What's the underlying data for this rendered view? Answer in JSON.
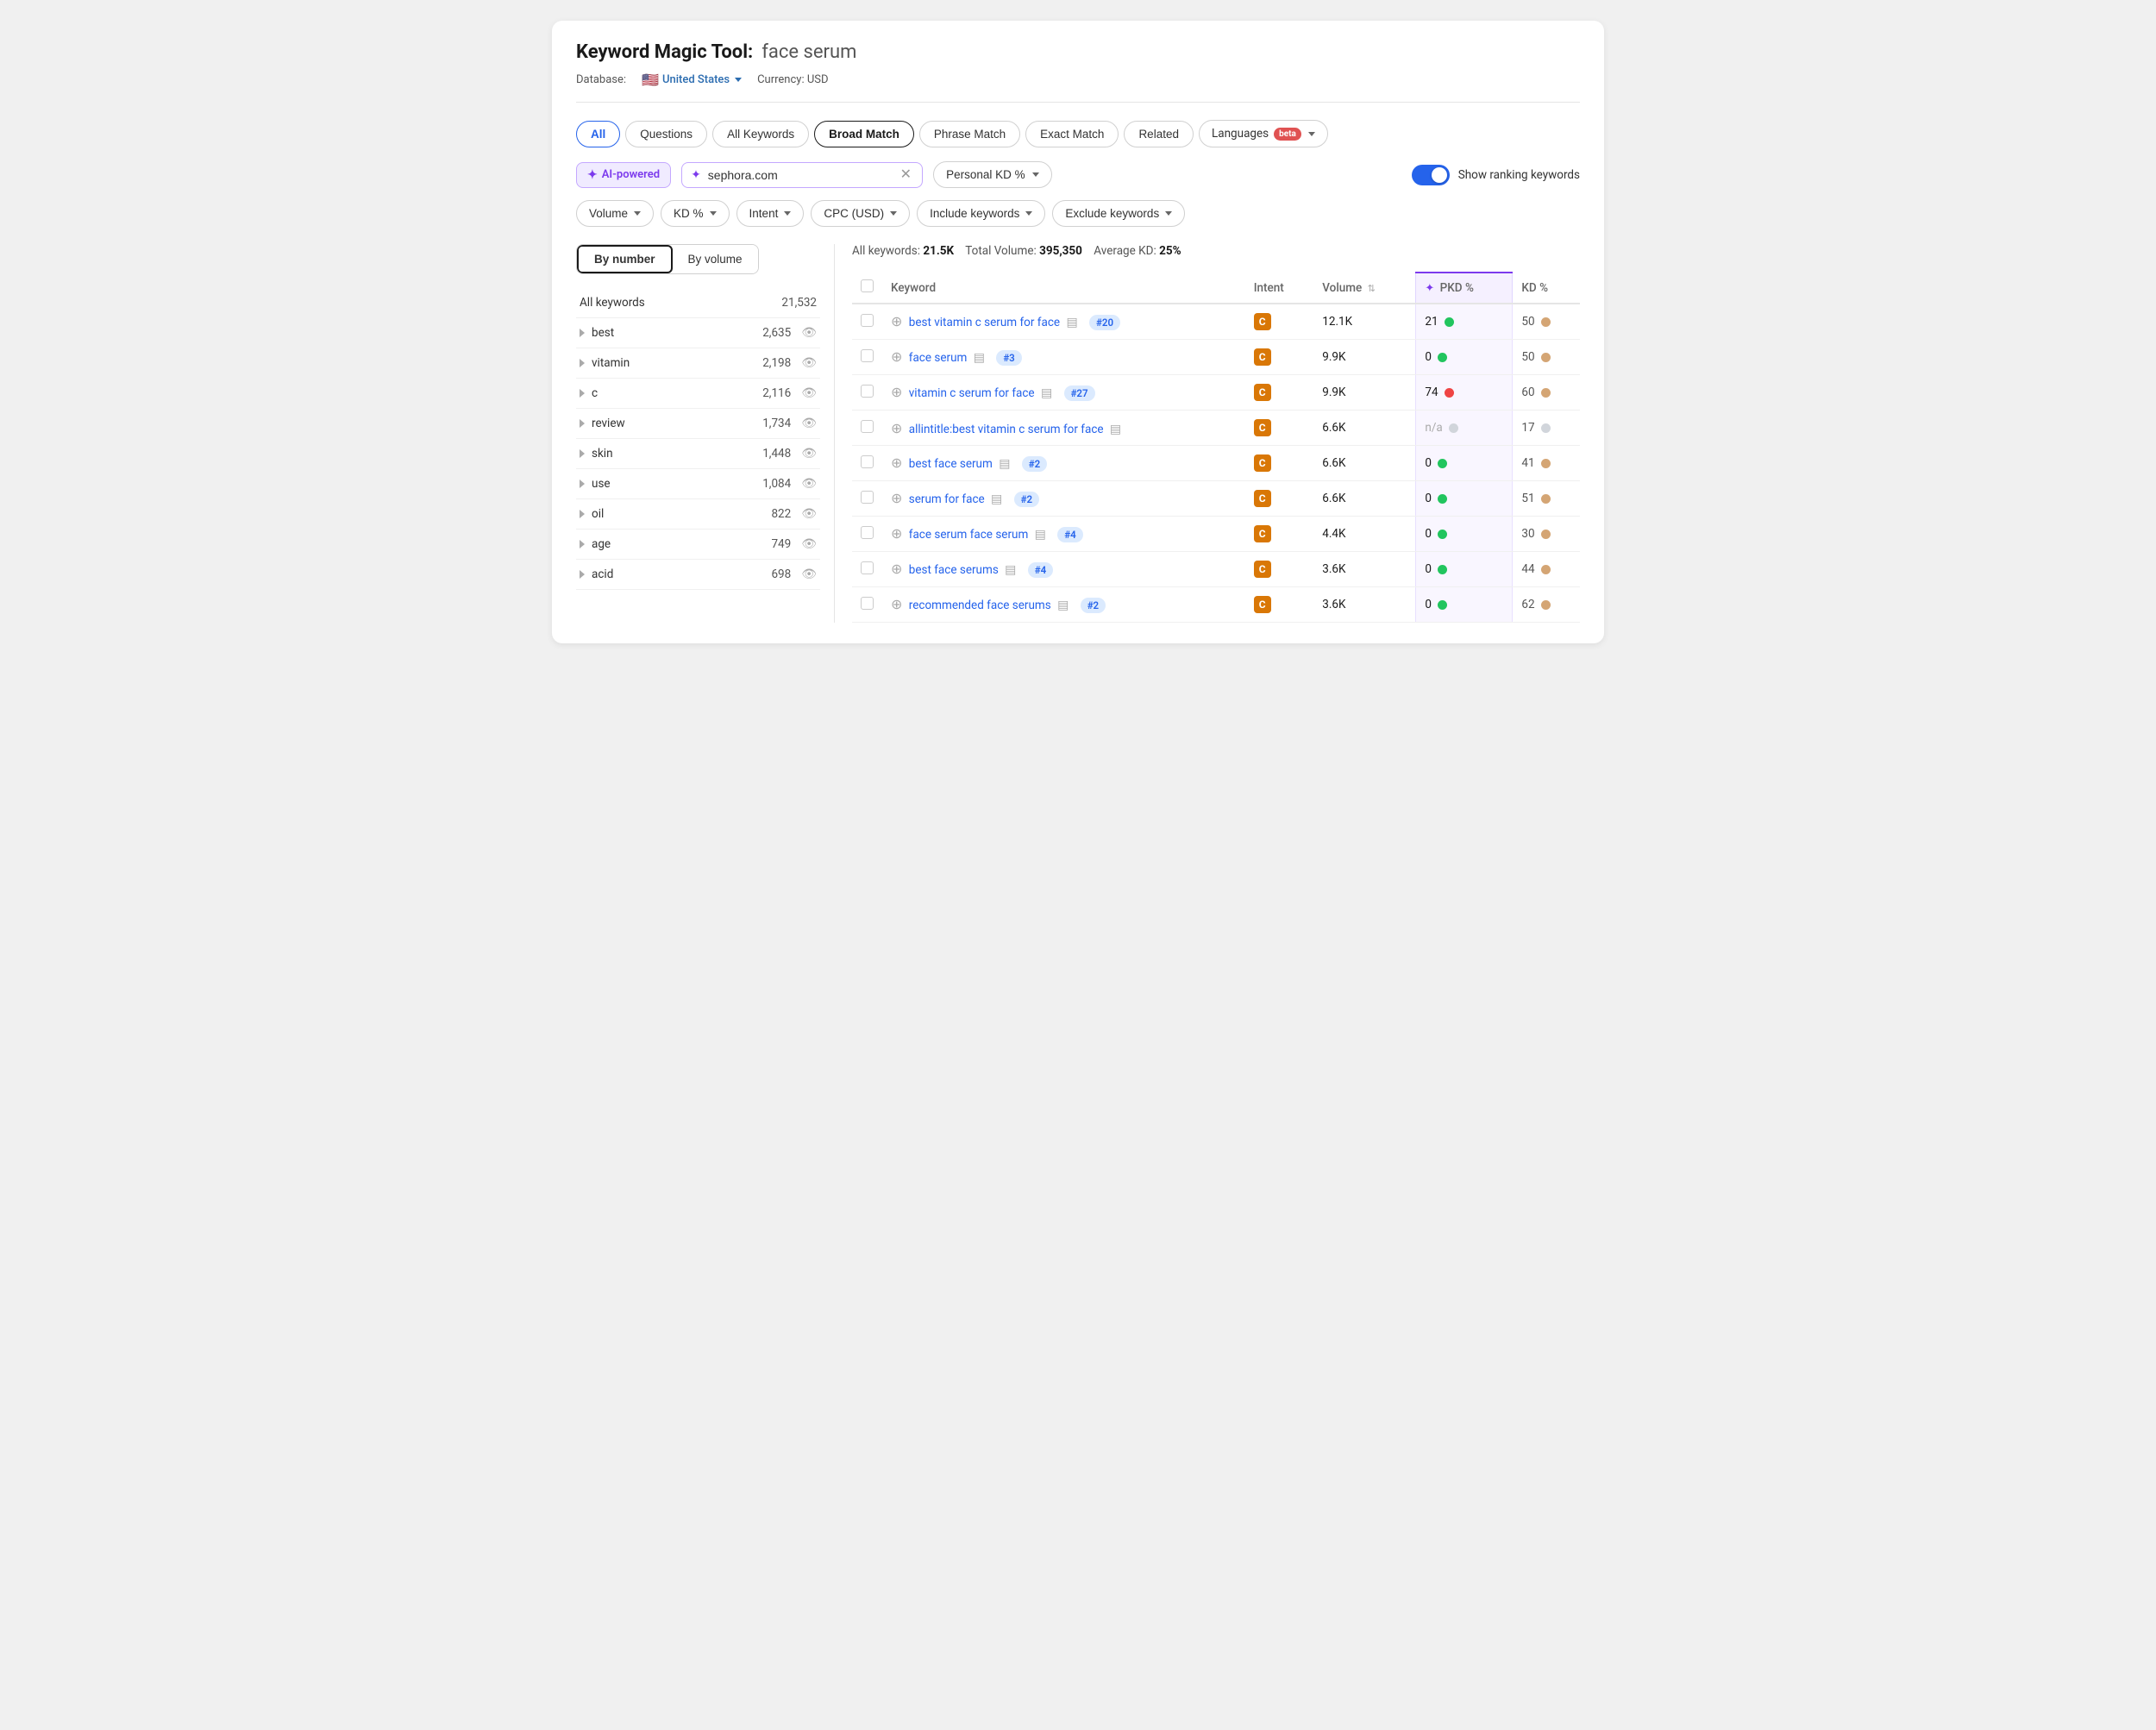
{
  "header": {
    "title_static": "Keyword Magic Tool:",
    "title_query": "face serum",
    "db_label": "Database:",
    "db_country": "United States",
    "currency_label": "Currency: USD"
  },
  "tabs": [
    {
      "id": "all",
      "label": "All",
      "active": true
    },
    {
      "id": "questions",
      "label": "Questions",
      "active": false
    },
    {
      "id": "all-keywords",
      "label": "All Keywords",
      "active": false
    },
    {
      "id": "broad-match",
      "label": "Broad Match",
      "active": false,
      "selected": true
    },
    {
      "id": "phrase-match",
      "label": "Phrase Match",
      "active": false
    },
    {
      "id": "exact-match",
      "label": "Exact Match",
      "active": false
    },
    {
      "id": "related",
      "label": "Related",
      "active": false
    },
    {
      "id": "languages",
      "label": "Languages",
      "active": false,
      "beta": true
    }
  ],
  "ai_search": {
    "badge_label": "AI-powered",
    "input_value": "sephora.com",
    "input_placeholder": "sephora.com"
  },
  "personal_kd_btn": "Personal KD %",
  "show_ranking_label": "Show ranking keywords",
  "filters": [
    {
      "id": "volume",
      "label": "Volume"
    },
    {
      "id": "kd",
      "label": "KD %"
    },
    {
      "id": "intent",
      "label": "Intent"
    },
    {
      "id": "cpc",
      "label": "CPC (USD)"
    },
    {
      "id": "include",
      "label": "Include keywords"
    },
    {
      "id": "exclude",
      "label": "Exclude keywords"
    }
  ],
  "sidebar": {
    "view_by_number": "By number",
    "view_by_volume": "By volume",
    "all_keywords_label": "All keywords",
    "all_keywords_count": "21,532",
    "items": [
      {
        "keyword": "best",
        "count": "2,635"
      },
      {
        "keyword": "vitamin",
        "count": "2,198"
      },
      {
        "keyword": "c",
        "count": "2,116"
      },
      {
        "keyword": "review",
        "count": "1,734"
      },
      {
        "keyword": "skin",
        "count": "1,448"
      },
      {
        "keyword": "use",
        "count": "1,084"
      },
      {
        "keyword": "oil",
        "count": "822"
      },
      {
        "keyword": "age",
        "count": "749"
      },
      {
        "keyword": "acid",
        "count": "698"
      }
    ]
  },
  "table_summary": {
    "label_all": "All keywords:",
    "value_all": "21.5K",
    "label_volume": "Total Volume:",
    "value_volume": "395,350",
    "label_kd": "Average KD:",
    "value_kd": "25%"
  },
  "table": {
    "columns": [
      "",
      "Keyword",
      "Intent",
      "Volume",
      "PKD %",
      "KD %"
    ],
    "rows": [
      {
        "keyword": "best vitamin c serum for face",
        "rank": "#20",
        "intent": "C",
        "volume": "12.1K",
        "pkd": "21",
        "pkd_dot": "green",
        "kd": "50",
        "kd_dot": "tan"
      },
      {
        "keyword": "face serum",
        "rank": "#3",
        "intent": "C",
        "volume": "9.9K",
        "pkd": "0",
        "pkd_dot": "green",
        "kd": "50",
        "kd_dot": "tan"
      },
      {
        "keyword": "vitamin c serum for face",
        "rank": "#27",
        "intent": "C",
        "volume": "9.9K",
        "pkd": "74",
        "pkd_dot": "red",
        "kd": "60",
        "kd_dot": "tan"
      },
      {
        "keyword": "allintitle:best vitamin c serum for face",
        "rank": null,
        "intent": "C",
        "volume": "6.6K",
        "pkd": "n/a",
        "pkd_dot": "gray",
        "kd": "17",
        "kd_dot": "gray"
      },
      {
        "keyword": "best face serum",
        "rank": "#2",
        "intent": "C",
        "volume": "6.6K",
        "pkd": "0",
        "pkd_dot": "green",
        "kd": "41",
        "kd_dot": "tan"
      },
      {
        "keyword": "serum for face",
        "rank": "#2",
        "intent": "C",
        "volume": "6.6K",
        "pkd": "0",
        "pkd_dot": "green",
        "kd": "51",
        "kd_dot": "tan"
      },
      {
        "keyword": "face serum face serum",
        "rank": "#4",
        "intent": "C",
        "volume": "4.4K",
        "pkd": "0",
        "pkd_dot": "green",
        "kd": "30",
        "kd_dot": "tan"
      },
      {
        "keyword": "best face serums",
        "rank": "#4",
        "intent": "C",
        "volume": "3.6K",
        "pkd": "0",
        "pkd_dot": "green",
        "kd": "44",
        "kd_dot": "tan"
      },
      {
        "keyword": "recommended face serums",
        "rank": "#2",
        "intent": "C",
        "volume": "3.6K",
        "pkd": "0",
        "pkd_dot": "green",
        "kd": "62",
        "kd_dot": "tan"
      }
    ]
  }
}
